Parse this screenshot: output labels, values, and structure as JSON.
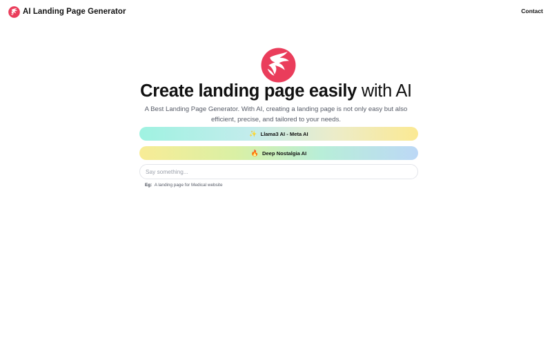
{
  "header": {
    "brand_name": "AI Landing Page Generator",
    "logo_icon": "phoenix-logo-icon",
    "contact_label": "Contact"
  },
  "hero": {
    "logo_icon": "phoenix-logo-icon",
    "title_strong": "Create landing page easily",
    "title_light": "with AI",
    "subtitle": "A Best Landing Page Generator. With AI, creating a landing page is not only easy but also efficient, precise, and tailored to your needs."
  },
  "models": [
    {
      "icon": "✨",
      "icon_name": "sparkles-icon",
      "label": "Llama3 AI - Meta AI"
    },
    {
      "icon": "🔥",
      "icon_name": "fire-icon",
      "label": "Deep Nostalgia AI"
    }
  ],
  "prompt": {
    "placeholder": "Say something...",
    "value": ""
  },
  "example": {
    "label": "Eg:",
    "text": "A landing page for Medical website"
  },
  "colors": {
    "brand": "#ea3d5b",
    "text": "#111111",
    "muted": "#555a66",
    "input_border": "#e3e5ea"
  }
}
